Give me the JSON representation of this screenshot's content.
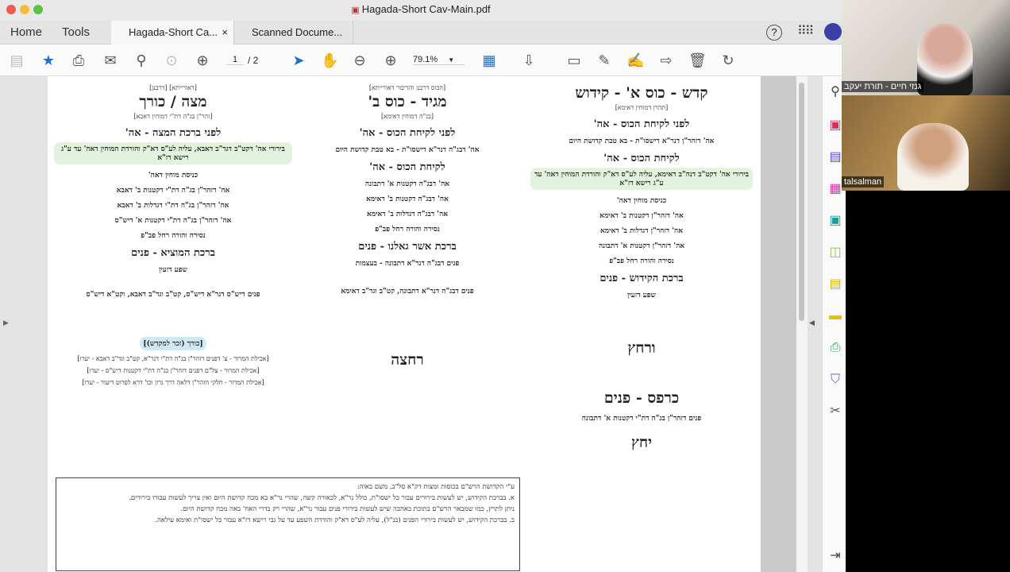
{
  "window": {
    "title": "Hagada-Short Cav-Main.pdf"
  },
  "nav": {
    "home": "Home",
    "tools": "Tools"
  },
  "tabs": [
    {
      "label": "Hagada-Short Ca...",
      "close": "×"
    },
    {
      "label": "Scanned Docume..."
    }
  ],
  "toolbar": {
    "page_current": "1",
    "page_total": "/ 2",
    "zoom": "79.1%"
  },
  "document": {
    "right_col": {
      "title": "קדש - כוס א' - קידוש",
      "sub": "[תהרן דמוחין דאימא]",
      "h1": "לפני לקיחת הכוס - אה'",
      "l1": "אה' דזהר\"ן דנר\"א דישסו\"ת - בא טבת קדושת היום",
      "h2": "לקיחת הכוס - אה'",
      "green": "בירורי אה' דקט\"ב דנה\"ב דאימא, עליה לע\"ס דא\"ק והורדת המוחין דאה' עד ע\"ג רישא דז\"א",
      "lines": [
        "כניסת מוחין דאה'",
        "אה' דזהר\"ן דקטנות ב' דאימא",
        "אה' דזהר\"ן דגדלות ב' דאימא",
        "אה' דזהר\"ן דקטנות א' דתבונה",
        "נסירה והורה רחל פב\"פ"
      ],
      "h3": "ברכת הקידוש - פנים",
      "l3": "שפע דזעין",
      "h4": "ורחץ",
      "h5": "כרפס - פנים",
      "l5": "פנים דזהר\"ן בג\"ה דת\"י דקטנות א' דתבונה",
      "h6": "יחץ"
    },
    "mid_col": {
      "pre": "[הכוס דרבנן והדיבור דאורייתא]",
      "title": "מגיד - כוס ב'",
      "sub": "[בג\"ה דמוחין דאימא]",
      "h1": "לפני לקיחת הכוס - אה'",
      "l1": "אה' דבג\"ה דנר\"א דישסו\"ת - בא טבת קדושת היום",
      "h2": "לקיחת הכוס - אה'",
      "lines": [
        "אה' דבג\"ה דקטנות א' דתבונה",
        "אה' דבג\"ה דקטנות ב' דאימא",
        "אה' דבג\"ה דגדלות ב' דאימא",
        "נסירה והורה רחל פב\"פ"
      ],
      "h3": "ברכת אשר גאלנו - פנים",
      "l3": "פנים דבג\"ה דנר\"א דתבונה - בעצמות",
      "l4": "פנים דבג\"ה דנר\"א דתבונה, קט\"ב וגד\"ב דאימא",
      "h4": "רחצה"
    },
    "left_col": {
      "pre": "[דאורייתא]     [דרבנן]",
      "title": "מצה / כורך",
      "sub": "[זהר\"ן בג\"ה דת\"י דמוחין דאבא]",
      "h1": "לפני ברכת המצה - אה'",
      "green": "בירורי אה' דקט\"ב דגד\"ב דאבא, עליה לע\"ס דא\"ק והורדת המוחין דאה' עד ע\"ג רישא דז\"א",
      "lines": [
        "כניסת מוחין דאה'",
        "אה' דזהר\"ן בג\"ה דת\"י דקטנות ב' דאבא",
        "אה' דזהר\"ן בג\"ה דת\"י דגדלות ב' דאבא",
        "אה' דזהר\"ן בג\"ה דת\"י דקטנות א' דיש\"ס",
        "נסירה והורה רחל פב\"פ"
      ],
      "h3": "ברכת המוציא - פנים",
      "l3": "שפע דזעין",
      "l4": "פנים דיש\"ס דנר\"א דיש\"ס, קט\"ב וגד\"ב דאבא, וקט\"א דיש\"ס",
      "korech": "[כורך (זכר למקדש)]",
      "notes": [
        "[אכילת המרור - צ' דפנים דזהר\"ן בג\"ה דת\"י דנר\"א, קט\"ב וגד\"ב דאבא - יערו]",
        "[אכילת המרור - צל\"ם דפנים דזהר\"ן בג\"ה דת\"י דקטנות דיש\"ס - יערו]",
        "[אכילת המרור - חלקי הזהר\"ן דלאה דרך גרון וכו' דרא לפרוט דיעור - יערו]"
      ]
    },
    "box": [
      "ע\"י הקדושת הרש\"ם בכוסות ומצות דק\"א סל\"ב, משם באוה:",
      "א. בברכת הקידוש, יש לעשות בירורים עבור כל ישסו\"ת, כולל נר\"א, לכאורה קשה, שהרי נר\"א בא מכח קדושת היום ואין צריך לעשות עבורו בירורים.",
      "ניתן לתרץ, כמו שמבאר הרש\"ם בתוכת באהבה שיש לעשות בירורי פנים עבור נר\"א, שהרי רק בדרי האח' באה מכח קדושת היום.",
      "ב. בברכת הקידוש, יש לעשות בירורי הפנים (כנ\"ל), עליה לע\"ס דא\"ק והורדת השפע עד על גבי רישא דז\"א עבור כל ישסו\"ת ואימא עילאה."
    ]
  },
  "participants": [
    {
      "name": "גנזי חיים - תורת יעקב"
    },
    {
      "name": "talsalman"
    }
  ]
}
